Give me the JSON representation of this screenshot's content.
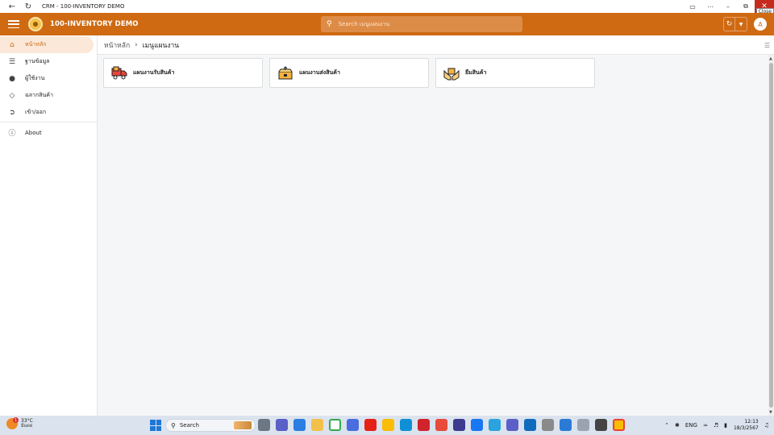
{
  "window": {
    "title": "CRM - 100-INVENTORY DEMO",
    "close_tooltip": "Close"
  },
  "header": {
    "app_name": "100-INVENTORY DEMO",
    "search_placeholder": "Search เมนูแผนงาน",
    "avatar_initial": "A",
    "accent_color": "#cf6a12"
  },
  "sidebar": {
    "items": [
      {
        "label": "หน้าหลัก",
        "icon": "home-icon",
        "active": true
      },
      {
        "label": "ฐานข้อมูล",
        "icon": "database-icon",
        "active": false
      },
      {
        "label": "ผู้ใช้งาน",
        "icon": "user-icon",
        "active": false
      },
      {
        "label": "ฉลากสินค้า",
        "icon": "tag-icon",
        "active": false
      },
      {
        "label": "เข้า/ออก",
        "icon": "login-icon",
        "active": false
      },
      {
        "label": "About",
        "icon": "info-icon",
        "active": false
      }
    ]
  },
  "breadcrumb": {
    "home": "หน้าหลัก",
    "current": "เมนูแผนงาน"
  },
  "cards": [
    {
      "label": "แผนงานรับสินค้า",
      "icon": "delivery-truck-icon"
    },
    {
      "label": "แผนงานส่งสินค้า",
      "icon": "package-box-icon"
    },
    {
      "label": "ยืมสินค้า",
      "icon": "hands-box-icon"
    }
  ],
  "taskbar": {
    "weather_temp": "33°C",
    "weather_condition": "มีแดด",
    "weather_badge": "1",
    "search_label": "Search",
    "language": "ENG",
    "time": "12:13",
    "date": "18/3/2567"
  }
}
